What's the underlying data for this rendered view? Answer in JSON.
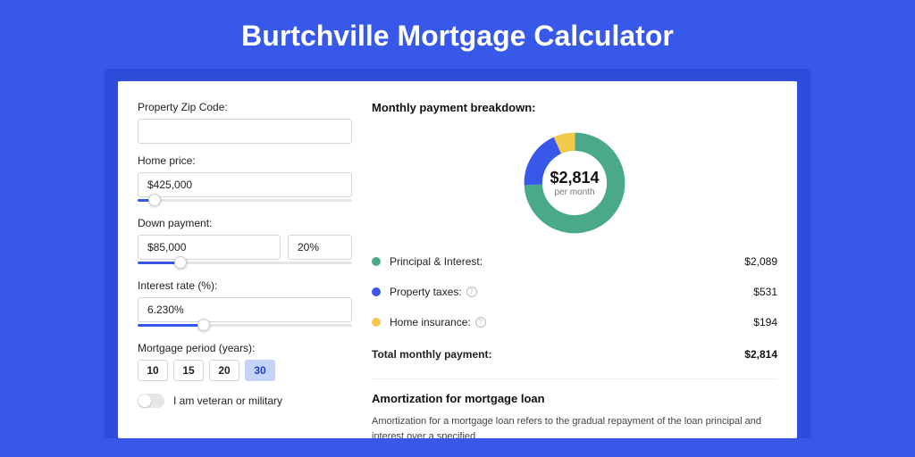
{
  "title": "Burtchville Mortgage Calculator",
  "colors": {
    "principal": "#4aa98a",
    "taxes": "#3858e9",
    "insurance": "#f2c94c"
  },
  "form": {
    "zip": {
      "label": "Property Zip Code:",
      "value": ""
    },
    "home_price": {
      "label": "Home price:",
      "value": "$425,000",
      "slider_pct": 8
    },
    "down_payment": {
      "label": "Down payment:",
      "amount": "$85,000",
      "percent": "20%",
      "slider_pct": 20
    },
    "interest": {
      "label": "Interest rate (%):",
      "value": "6.230%",
      "slider_pct": 31
    },
    "period": {
      "label": "Mortgage period (years):",
      "options": [
        "10",
        "15",
        "20",
        "30"
      ],
      "selected_index": 3
    },
    "veteran": {
      "label": "I am veteran or military",
      "checked": false
    }
  },
  "breakdown": {
    "title": "Monthly payment breakdown:",
    "total_amount": "$2,814",
    "total_sub": "per month",
    "rows": [
      {
        "key": "principal",
        "label": "Principal & Interest:",
        "value": "$2,089",
        "info": false
      },
      {
        "key": "taxes",
        "label": "Property taxes:",
        "value": "$531",
        "info": true
      },
      {
        "key": "insurance",
        "label": "Home insurance:",
        "value": "$194",
        "info": true
      }
    ],
    "total_label": "Total monthly payment:",
    "total_value": "$2,814"
  },
  "amortization": {
    "title": "Amortization for mortgage loan",
    "text": "Amortization for a mortgage loan refers to the gradual repayment of the loan principal and interest over a specified"
  },
  "chart_data": {
    "type": "pie",
    "title": "Monthly payment breakdown",
    "series": [
      {
        "name": "Principal & Interest",
        "value": 2089
      },
      {
        "name": "Property taxes",
        "value": 531
      },
      {
        "name": "Home insurance",
        "value": 194
      }
    ],
    "total": 2814,
    "unit": "USD per month"
  }
}
